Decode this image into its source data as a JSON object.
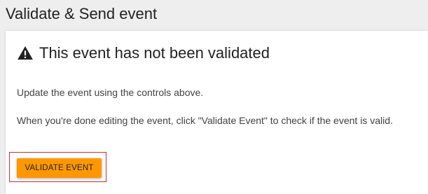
{
  "section": {
    "title": "Validate & Send event"
  },
  "status": {
    "icon": "warning-icon",
    "heading": "This event has not been validated"
  },
  "instructions": {
    "line1": "Update the event using the controls above.",
    "line2": "When you're done editing the event, click \"Validate Event\" to check if the event is valid."
  },
  "actions": {
    "validate_label": "Validate Event"
  },
  "colors": {
    "button": "#ff9800",
    "highlight": "#cc2e2e",
    "background": "#eeeeee"
  }
}
